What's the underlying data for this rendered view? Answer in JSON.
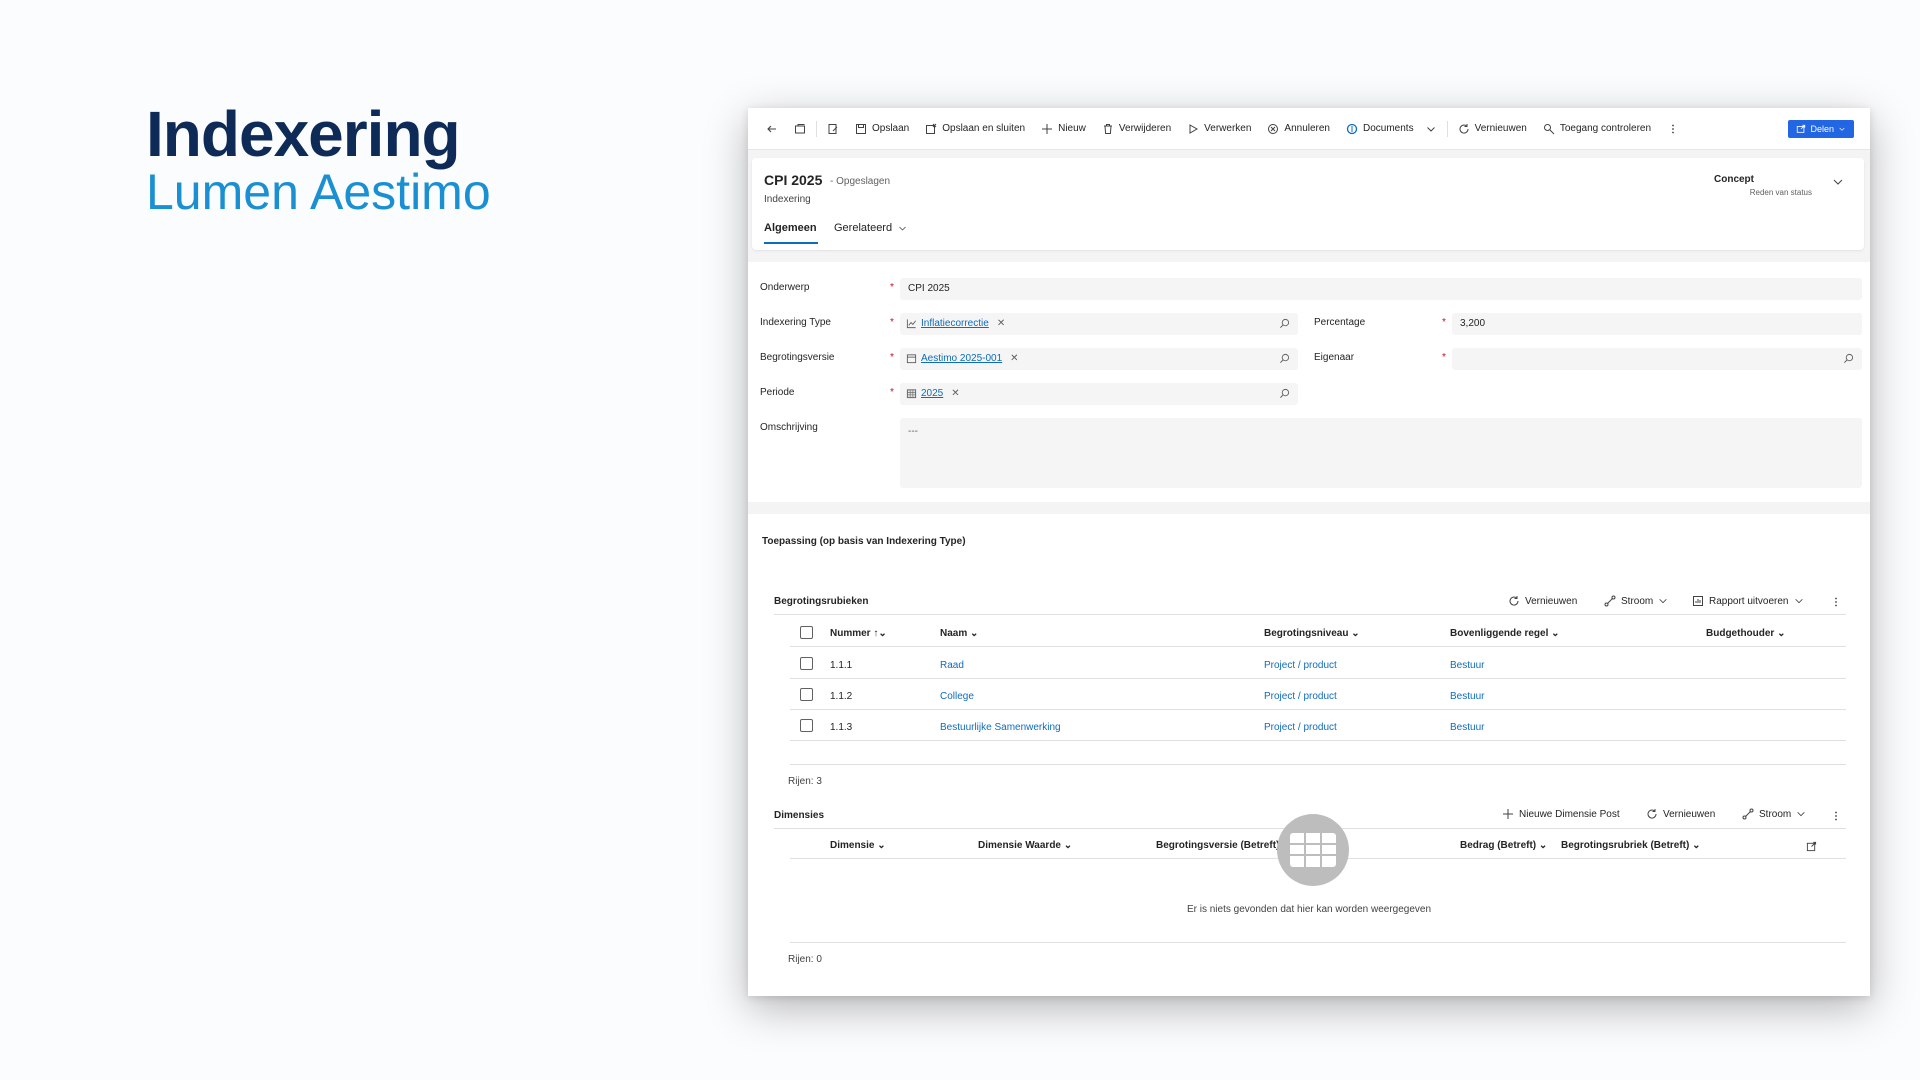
{
  "hero": {
    "title": "Indexering",
    "subtitle": "Lumen Aestimo"
  },
  "toolbar": {
    "items": [
      {
        "label": "Opslaan",
        "icon": "save-icon"
      },
      {
        "label": "Opslaan en sluiten",
        "icon": "save-close-icon"
      },
      {
        "label": "Nieuw",
        "icon": "plus-icon"
      },
      {
        "label": "Verwijderen",
        "icon": "trash-icon"
      },
      {
        "label": "Verwerken",
        "icon": "play-icon"
      },
      {
        "label": "Annuleren",
        "icon": "cancel-icon"
      },
      {
        "label": "Documents",
        "icon": "sharepoint-icon"
      },
      {
        "label": "Vernieuwen",
        "icon": "refresh-icon"
      },
      {
        "label": "Toegang controleren",
        "icon": "access-icon"
      }
    ],
    "share_label": "Delen"
  },
  "record": {
    "title": "CPI 2025",
    "saved_status": "- Opgeslagen",
    "entity": "Indexering",
    "status_value": "Concept",
    "status_label": "Reden van status",
    "tabs": [
      "Algemeen",
      "Gerelateerd"
    ]
  },
  "form": {
    "onderwerp_label": "Onderwerp",
    "onderwerp_value": "CPI 2025",
    "indexering_type_label": "Indexering Type",
    "indexering_type_value": "Inflatiecorrectie",
    "percentage_label": "Percentage",
    "percentage_value": "3,200",
    "begrotingsversie_label": "Begrotingsversie",
    "begrotingsversie_value": "Aestimo 2025-001",
    "eigenaar_label": "Eigenaar",
    "periode_label": "Periode",
    "periode_value": "2025",
    "omschrijving_label": "Omschrijving",
    "omschrijving_value": "---",
    "required_mark": "*"
  },
  "toepassing": {
    "title": "Toepassing (op basis van Indexering Type)",
    "rubrieken": {
      "title": "Begrotingsrubieken",
      "commands": [
        "Vernieuwen",
        "Stroom",
        "Rapport uitvoeren"
      ],
      "columns": [
        "Nummer",
        "Naam",
        "Begrotingsniveau",
        "Bovenliggende regel",
        "Budgethouder"
      ],
      "rows": [
        {
          "nummer": "1.1.1",
          "naam": "Raad",
          "niveau": "Project / product",
          "bovenliggend": "Bestuur"
        },
        {
          "nummer": "1.1.2",
          "naam": "College",
          "niveau": "Project / product",
          "bovenliggend": "Bestuur"
        },
        {
          "nummer": "1.1.3",
          "naam": "Bestuurlijke Samenwerking",
          "niveau": "Project / product",
          "bovenliggend": "Bestuur"
        }
      ],
      "rows_count": "Rijen: 3"
    },
    "dimensies": {
      "title": "Dimensies",
      "commands": [
        "Nieuwe Dimensie Post",
        "Vernieuwen",
        "Stroom"
      ],
      "columns": [
        "Dimensie",
        "Dimensie Waarde",
        "Begrotingsversie (Betreft)",
        "Bedrag (Betreft)",
        "Begrotingsrubriek (Betreft)"
      ],
      "empty_text": "Er is niets gevonden dat hier kan worden weergegeven",
      "rows_count": "Rijen: 0"
    }
  },
  "colors": {
    "accent": "#0f6cbd",
    "hero_title": "#0e2a57",
    "hero_sub": "#1a8fd1",
    "primary_button": "#2266e3"
  }
}
